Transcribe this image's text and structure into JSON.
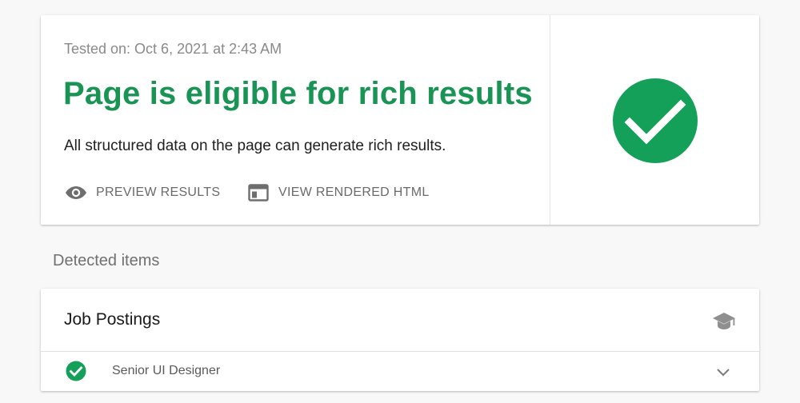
{
  "result": {
    "tested_on": "Tested on: Oct 6, 2021 at 2:43 AM",
    "headline": "Page is eligible for rich results",
    "subline": "All structured data on the page can generate rich results.",
    "actions": {
      "preview": {
        "label": "PREVIEW RESULTS",
        "icon": "eye-icon"
      },
      "rendered": {
        "label": "VIEW RENDERED HTML",
        "icon": "browser-window-icon"
      }
    },
    "status_icon": "check-circle-icon",
    "status_color": "#15a05a"
  },
  "detected": {
    "section_label": "Detected items",
    "group": {
      "title": "Job Postings",
      "icon": "graduation-cap-icon",
      "items": [
        {
          "label": "Senior UI Designer",
          "status_icon": "check-circle-icon",
          "expand_icon": "chevron-down-icon"
        }
      ]
    }
  },
  "colors": {
    "success_green": "#1a9454",
    "page_background": "#f8f8f8",
    "card_background": "#ffffff"
  }
}
